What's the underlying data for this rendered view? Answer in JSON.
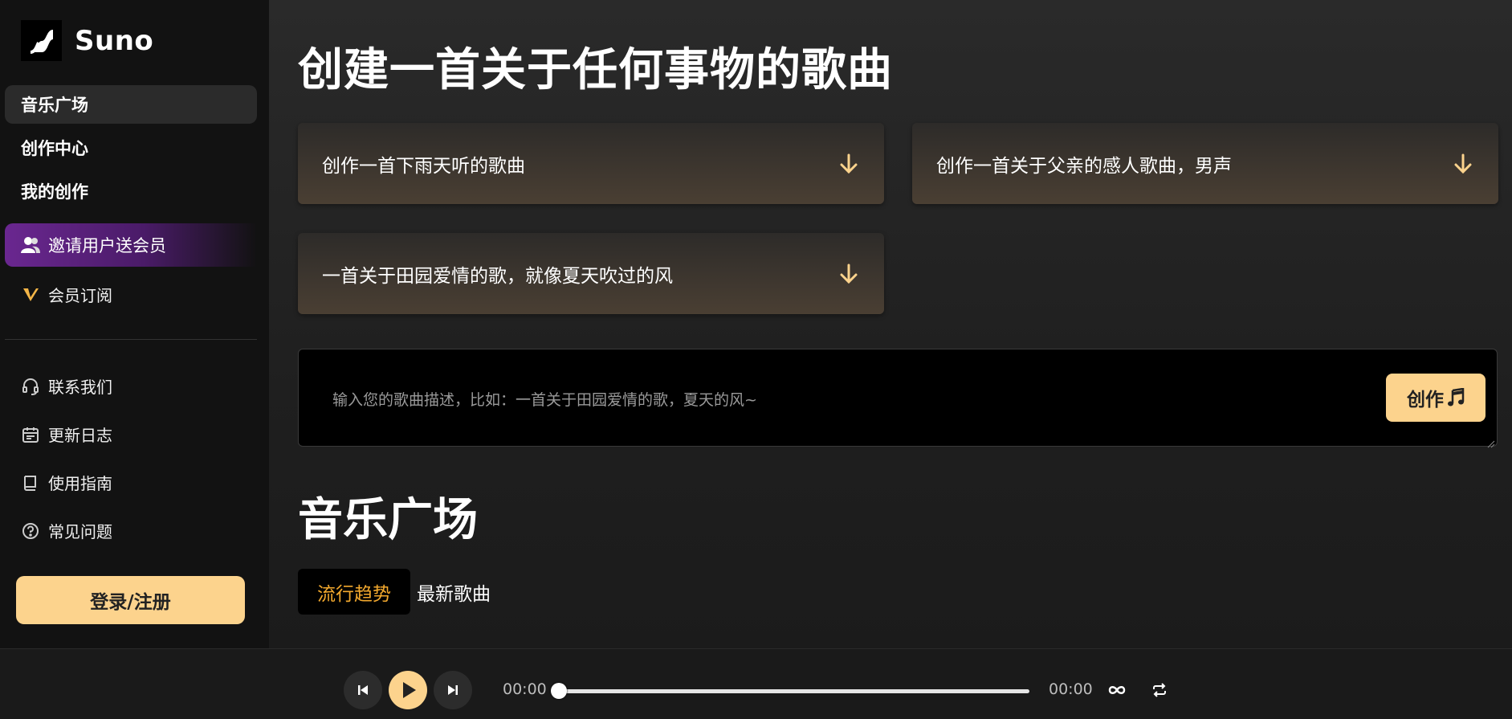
{
  "brand": {
    "name": "Suno"
  },
  "sidebar": {
    "nav": [
      {
        "label": "音乐广场",
        "active": true
      },
      {
        "label": "创作中心",
        "active": false
      },
      {
        "label": "我的创作",
        "active": false
      }
    ],
    "promo": {
      "label": "邀请用户送会员",
      "icon": "users-icon"
    },
    "subscribe": {
      "label": "会员订阅",
      "icon": "v-badge-icon"
    },
    "menu": [
      {
        "label": "联系我们",
        "icon": "headset-icon"
      },
      {
        "label": "更新日志",
        "icon": "calendar-icon"
      },
      {
        "label": "使用指南",
        "icon": "book-icon"
      },
      {
        "label": "常见问题",
        "icon": "question-icon"
      }
    ],
    "login_label": "登录/注册"
  },
  "main": {
    "title": "创建一首关于任何事物的歌曲",
    "suggestions": [
      "创作一首下雨天听的歌曲",
      "创作一首关于父亲的感人歌曲，男声",
      "一首关于田园爱情的歌，就像夏天吹过的风"
    ],
    "prompt_placeholder": "输入您的歌曲描述，比如：一首关于田园爱情的歌，夏天的风~",
    "create_label": "创作",
    "section_title": "音乐广场",
    "tabs": [
      {
        "label": "流行趋势",
        "active": true
      },
      {
        "label": "最新歌曲",
        "active": false
      }
    ]
  },
  "player": {
    "current_time": "00:00",
    "total_time": "00:00",
    "progress": 0
  },
  "colors": {
    "accent": "#fcd38d",
    "tab_active_text": "#f3a92e",
    "promo_purple": "#6a2790"
  }
}
